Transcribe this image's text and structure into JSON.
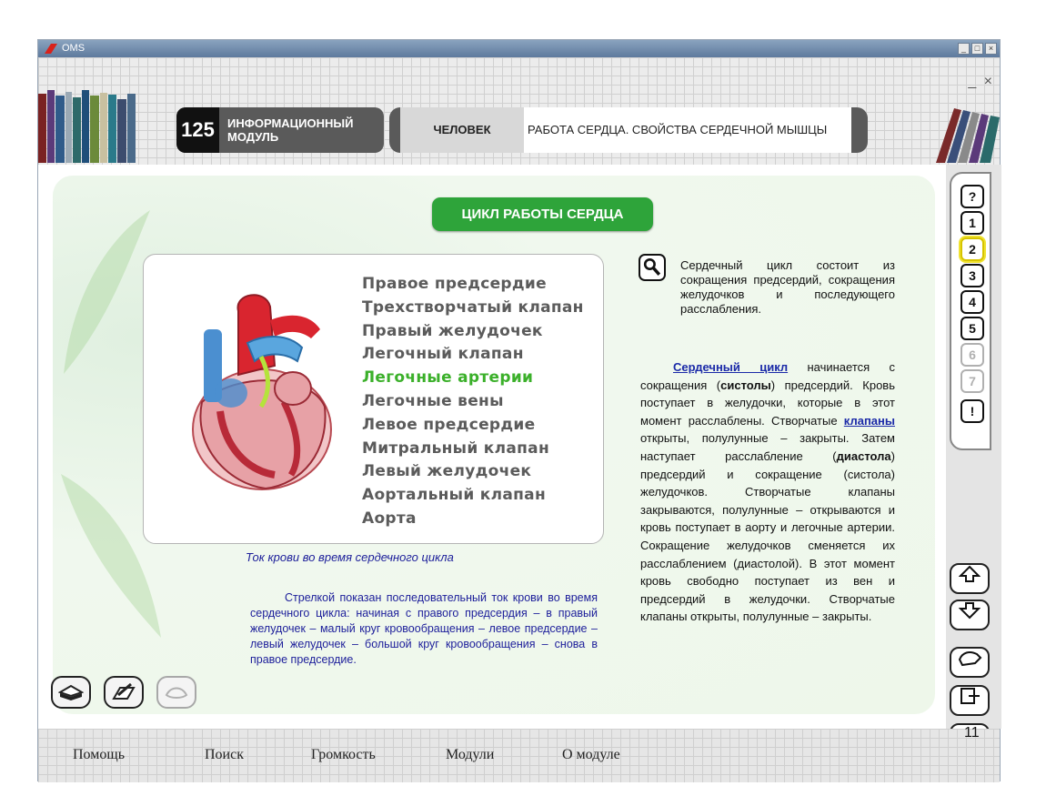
{
  "window": {
    "title": "OMS",
    "controls": [
      "_",
      "□",
      "×"
    ]
  },
  "header": {
    "module_number": "125",
    "module_label_line1": "ИНФОРМАЦИОННЫЙ",
    "module_label_line2": "МОДУЛЬ",
    "category": "ЧЕЛОВЕК",
    "topic_title": "РАБОТА СЕРДЦА. СВОЙСТВА СЕРДЕЧНОЙ МЫШЦЫ",
    "window_controls_text": "_ ×"
  },
  "section": {
    "title": "ЦИКЛ РАБОТЫ СЕРДЦА",
    "parts": [
      "Правое предсердие",
      "Трехстворчатый клапан",
      "Правый желудочек",
      "Легочный клапан",
      "Легочные артерии",
      "Легочные вены",
      "Левое предсердие",
      "Митральный клапан",
      "Левый желудочек",
      "Аортальный клапан",
      "Аорта"
    ],
    "active_part": "Легочные артерии",
    "caption": "Ток крови во время сердечного цикла",
    "caption_text": "Стрелкой показан последовательный ток крови во время сердечного цикла: начиная с правого предсердия – в правый желудочек – малый круг кровообращения – левое предсердие – левый желудочек – большой круг кровообращения – снова в правое предсердие.",
    "intro_text": "Сердечный цикл состоит из сокращения предсердий, сокращения желудочков и последующего расслабления.",
    "main_text": {
      "link1": "Сердечный цикл",
      "p1": " начинается с сокращения (",
      "b1": "систолы",
      "p2": ") предсердий. Кровь поступает в желудочки, которые в этот момент расслаблены. Створчатые ",
      "link2": "клапаны",
      "p3": " открыты, полулунные – закрыты. Затем наступает расслабление (",
      "b2": "диастола",
      "p4": ") предсердий и сокращение (систола) желудочков. Створчатые клапаны закрываются, полулунные – открываются и кровь поступает в аорту и легочные артерии. Сокращение желудочков сменяется их расслаблением (диастолой). В этот момент кровь свободно поступает из вен и предсердий в желудочки. Створчатые клапаны открыты, полулунные – закрыты."
    }
  },
  "rail": {
    "tabs": [
      "?",
      "1",
      "2",
      "3",
      "4",
      "5",
      "6",
      "7",
      "!"
    ],
    "current_tab": 2,
    "disabled_tabs": [
      6,
      7
    ],
    "help_label": "help"
  },
  "footer": {
    "menu": [
      "Помощь",
      "Поиск",
      "Громкость",
      "Модули",
      "О модуле"
    ]
  },
  "slide_number": "11",
  "colors": {
    "title_green": "#2ea43a",
    "active_part": "#3bb02a",
    "link_blue": "#1b2aa8",
    "caption_blue": "#1c1e9a"
  }
}
